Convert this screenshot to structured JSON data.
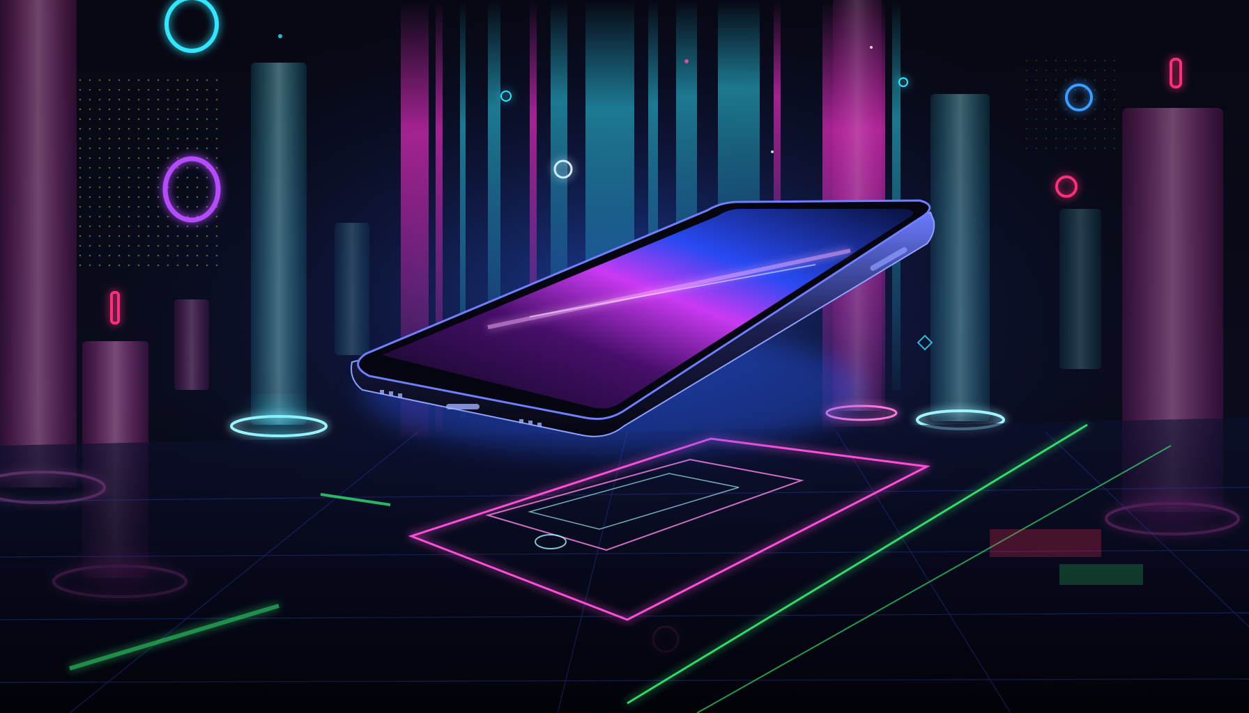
{
  "scene": {
    "subject": "floating-smartphone-icon",
    "background": "#05060c",
    "palette": {
      "magenta": "#ff2fd0",
      "pink": "#ff4fae",
      "cyan": "#30e6ff",
      "blue": "#3a6dff",
      "green": "#39ff7a",
      "violet": "#8a3cff"
    },
    "icons": [
      "light-pillar-icon",
      "neon-ring-icon",
      "circuit-grid-icon",
      "phone-screen-icon",
      "dot-matrix-icon"
    ]
  }
}
